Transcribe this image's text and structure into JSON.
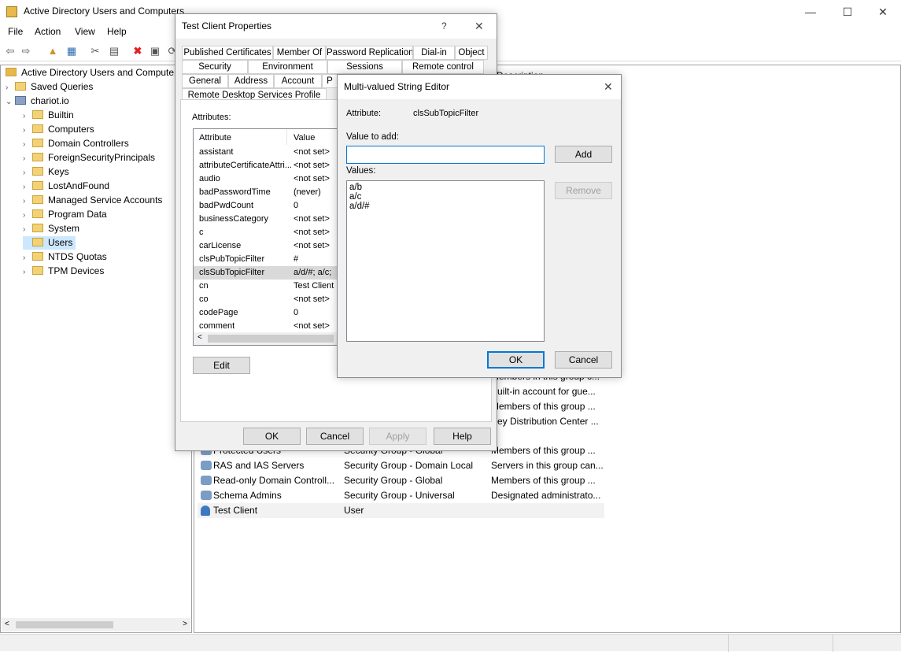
{
  "window": {
    "title": "Active Directory Users and Computers"
  },
  "menu": [
    "File",
    "Action",
    "View",
    "Help"
  ],
  "tree": {
    "root": "Active Directory Users and Computer",
    "items": [
      {
        "label": "Saved Queries",
        "level": 1,
        "expanded": false
      },
      {
        "label": "chariot.io",
        "level": 1,
        "expanded": true
      },
      {
        "label": "Builtin",
        "level": 2
      },
      {
        "label": "Computers",
        "level": 2
      },
      {
        "label": "Domain Controllers",
        "level": 2
      },
      {
        "label": "ForeignSecurityPrincipals",
        "level": 2
      },
      {
        "label": "Keys",
        "level": 2
      },
      {
        "label": "LostAndFound",
        "level": 2
      },
      {
        "label": "Managed Service Accounts",
        "level": 2
      },
      {
        "label": "Program Data",
        "level": 2
      },
      {
        "label": "System",
        "level": 2
      },
      {
        "label": "Users",
        "level": 2,
        "selected": true
      },
      {
        "label": "NTDS Quotas",
        "level": 2
      },
      {
        "label": "TPM Devices",
        "level": 2
      }
    ]
  },
  "list": {
    "desc_header": "Description",
    "partial_desc": [
      "Members in this group c...",
      "Built-in account for gue...",
      "Members of this group ...",
      "Key Distribution Center ..."
    ],
    "rows": [
      {
        "name": "Protected Users",
        "type": "Security Group - Global",
        "desc": "Members of this group ..."
      },
      {
        "name": "RAS and IAS Servers",
        "type": "Security Group - Domain Local",
        "desc": "Servers in this group can..."
      },
      {
        "name": "Read-only Domain Controll...",
        "type": "Security Group - Global",
        "desc": "Members of this group ..."
      },
      {
        "name": "Schema Admins",
        "type": "Security Group - Universal",
        "desc": "Designated administrato..."
      },
      {
        "name": "Test Client",
        "type": "User",
        "desc": ""
      }
    ]
  },
  "props": {
    "title": "Test Client Properties",
    "help_glyph": "?",
    "close_glyph": "✕",
    "tabs_row1": [
      "Published Certificates",
      "Member Of",
      "Password Replication",
      "Dial-in",
      "Object"
    ],
    "tabs_row2": [
      "Security",
      "Environment",
      "Sessions",
      "Remote control"
    ],
    "tabs_row3": [
      "General",
      "Address",
      "Account",
      "P"
    ],
    "tabs_row4": [
      "Remote Desktop Services Profile"
    ],
    "attributes_label": "Attributes:",
    "col_attribute": "Attribute",
    "col_value": "Value",
    "attrs": [
      {
        "name": "assistant",
        "value": "<not set>"
      },
      {
        "name": "attributeCertificateAttri...",
        "value": "<not set>"
      },
      {
        "name": "audio",
        "value": "<not set>"
      },
      {
        "name": "badPasswordTime",
        "value": "(never)"
      },
      {
        "name": "badPwdCount",
        "value": "0"
      },
      {
        "name": "businessCategory",
        "value": "<not set>"
      },
      {
        "name": "c",
        "value": "<not set>"
      },
      {
        "name": "carLicense",
        "value": "<not set>"
      },
      {
        "name": "clsPubTopicFilter",
        "value": "#"
      },
      {
        "name": "clsSubTopicFilter",
        "value": "a/d/#; a/c;"
      },
      {
        "name": "cn",
        "value": "Test Client"
      },
      {
        "name": "co",
        "value": "<not set>"
      },
      {
        "name": "codePage",
        "value": "0"
      },
      {
        "name": "comment",
        "value": "<not set>"
      }
    ],
    "edit": "Edit",
    "ok": "OK",
    "cancel": "Cancel",
    "apply": "Apply",
    "help": "Help"
  },
  "mv": {
    "title": "Multi-valued String Editor",
    "close_glyph": "✕",
    "attribute_label": "Attribute:",
    "attribute_value": "clsSubTopicFilter",
    "value_to_add_label": "Value to add:",
    "value_to_add": "",
    "add": "Add",
    "values_label": "Values:",
    "values": [
      "a/b",
      "a/c",
      "a/d/#"
    ],
    "remove": "Remove",
    "ok": "OK",
    "cancel": "Cancel"
  }
}
